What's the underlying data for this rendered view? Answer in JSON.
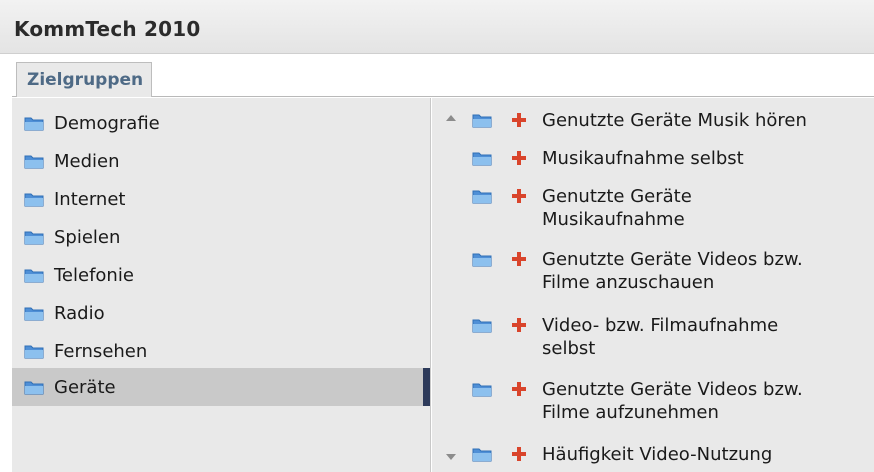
{
  "window": {
    "title": "KommTech 2010"
  },
  "tabs": [
    {
      "label": "Zielgruppen"
    }
  ],
  "sidebar": {
    "items": [
      {
        "label": "Demografie",
        "icon": "folder-icon"
      },
      {
        "label": "Medien",
        "icon": "folder-icon"
      },
      {
        "label": "Internet",
        "icon": "folder-icon"
      },
      {
        "label": "Spielen",
        "icon": "folder-icon"
      },
      {
        "label": "Telefonie",
        "icon": "folder-icon"
      },
      {
        "label": "Radio",
        "icon": "folder-icon"
      },
      {
        "label": "Fernsehen",
        "icon": "folder-icon"
      },
      {
        "label": "Geräte",
        "icon": "folder-icon",
        "selected": true
      }
    ]
  },
  "content": {
    "items": [
      {
        "lines": [
          "Genutzte Geräte Musik hören"
        ]
      },
      {
        "lines": [
          "Musikaufnahme selbst"
        ]
      },
      {
        "lines": [
          "Genutzte Geräte",
          "Musikaufnahme"
        ]
      },
      {
        "lines": [
          "Genutzte Geräte Videos bzw.",
          "Filme anzuschauen"
        ]
      },
      {
        "lines": [
          "Video- bzw. Filmaufnahme",
          "selbst"
        ]
      },
      {
        "lines": [
          "Genutzte Geräte Videos bzw.",
          "Filme aufzunehmen"
        ]
      },
      {
        "lines": [
          "Häufigkeit Video-Nutzung"
        ]
      }
    ]
  },
  "colors": {
    "accent_plus": "#d9442b",
    "selection_bar": "#2d3a5a",
    "tab_text": "#4e6a86",
    "folder": "#4f8fd6"
  }
}
